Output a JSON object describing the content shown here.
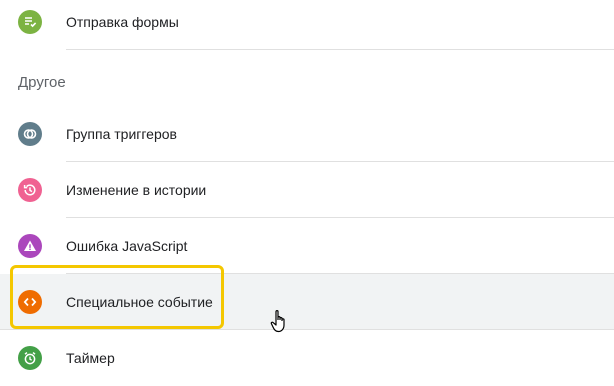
{
  "items_top": [
    {
      "label": "Отправка формы",
      "icon": "form-submit-icon",
      "color": "#7cb342"
    }
  ],
  "section_title": "Другое",
  "items_other": [
    {
      "label": "Группа триггеров",
      "icon": "trigger-group-icon",
      "color": "#607d8b"
    },
    {
      "label": "Изменение в истории",
      "icon": "history-change-icon",
      "color": "#f06292"
    },
    {
      "label": "Ошибка JavaScript",
      "icon": "js-error-icon",
      "color": "#ab47bc"
    },
    {
      "label": "Специальное событие",
      "icon": "custom-event-icon",
      "color": "#ef6c00",
      "hovered": true,
      "highlighted": true
    },
    {
      "label": "Таймер",
      "icon": "timer-icon",
      "color": "#43a047"
    }
  ],
  "colors": {
    "highlight_border": "#f4c700",
    "hover_background": "#f1f3f4",
    "divider": "#e0e0e0"
  }
}
